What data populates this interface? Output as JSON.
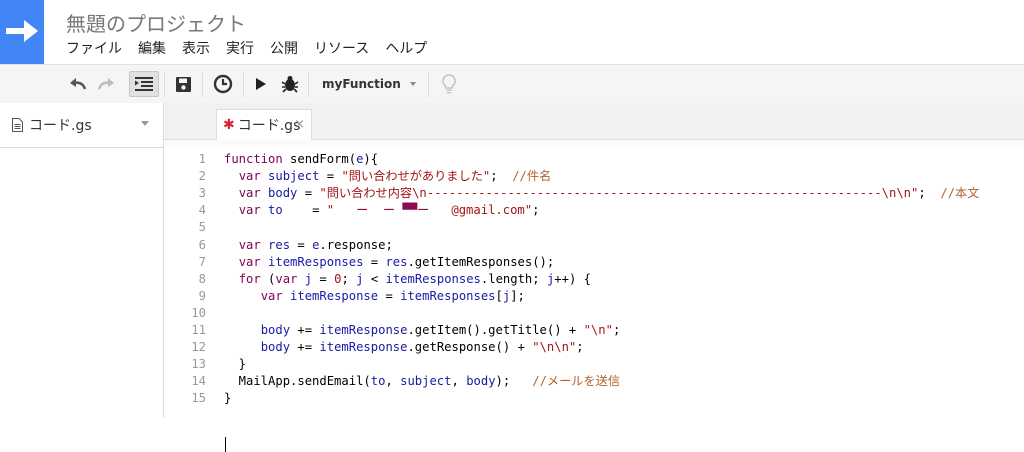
{
  "app": {
    "title": "無題のプロジェクト",
    "menu": [
      "ファイル",
      "編集",
      "表示",
      "実行",
      "公開",
      "リソース",
      "ヘルプ"
    ]
  },
  "toolbar": {
    "function_select": "myFunction"
  },
  "sidebar": {
    "file_label": "コード.gs"
  },
  "tab": {
    "star": "✱",
    "label": "コード.gs",
    "close": "×"
  },
  "editor": {
    "line_numbers": [
      "1",
      "2",
      "3",
      "4",
      "5",
      "6",
      "7",
      "8",
      "9",
      "10",
      "11",
      "12",
      "13",
      "14",
      "15"
    ],
    "lines": [
      [
        [
          "kw",
          "function"
        ],
        [
          "tx",
          " sendForm("
        ],
        [
          "vr",
          "e"
        ],
        [
          "tx",
          "){"
        ]
      ],
      [
        [
          "tx",
          "  "
        ],
        [
          "kw",
          "var"
        ],
        [
          "tx",
          " "
        ],
        [
          "vr",
          "subject"
        ],
        [
          "tx",
          " = "
        ],
        [
          "st",
          "\"問い合わせがありました\""
        ],
        [
          "tx",
          ";  "
        ],
        [
          "cm",
          "//件名"
        ]
      ],
      [
        [
          "tx",
          "  "
        ],
        [
          "kw",
          "var"
        ],
        [
          "tx",
          " "
        ],
        [
          "vr",
          "body"
        ],
        [
          "tx",
          " = "
        ],
        [
          "st",
          "\"問い合わせ内容\\n--------------------------------------------------------------\\n\\n\""
        ],
        [
          "tx",
          ";  "
        ],
        [
          "cm",
          "//本文"
        ]
      ],
      [
        [
          "tx",
          "  "
        ],
        [
          "kw",
          "var"
        ],
        [
          "tx",
          " "
        ],
        [
          "vr",
          "to"
        ],
        [
          "tx",
          "    = "
        ],
        [
          "st",
          "\"   "
        ],
        [
          "mask",
          "ー  ー ▀▀ー"
        ],
        [
          "st",
          "   @gmail.com\""
        ],
        [
          "tx",
          ";"
        ]
      ],
      [
        [
          "tx",
          ""
        ]
      ],
      [
        [
          "tx",
          "  "
        ],
        [
          "kw",
          "var"
        ],
        [
          "tx",
          " "
        ],
        [
          "vr",
          "res"
        ],
        [
          "tx",
          " = "
        ],
        [
          "vr",
          "e"
        ],
        [
          "tx",
          ".response;"
        ]
      ],
      [
        [
          "tx",
          "  "
        ],
        [
          "kw",
          "var"
        ],
        [
          "tx",
          " "
        ],
        [
          "vr",
          "itemResponses"
        ],
        [
          "tx",
          " = "
        ],
        [
          "vr",
          "res"
        ],
        [
          "tx",
          ".getItemResponses();"
        ]
      ],
      [
        [
          "tx",
          "  "
        ],
        [
          "kw",
          "for"
        ],
        [
          "tx",
          " ("
        ],
        [
          "kw",
          "var"
        ],
        [
          "tx",
          " "
        ],
        [
          "vr",
          "j"
        ],
        [
          "tx",
          " = "
        ],
        [
          "nu",
          "0"
        ],
        [
          "tx",
          "; "
        ],
        [
          "vr",
          "j"
        ],
        [
          "tx",
          " < "
        ],
        [
          "vr",
          "itemResponses"
        ],
        [
          "tx",
          ".length; "
        ],
        [
          "vr",
          "j"
        ],
        [
          "tx",
          "++) {"
        ]
      ],
      [
        [
          "tx",
          "     "
        ],
        [
          "kw",
          "var"
        ],
        [
          "tx",
          " "
        ],
        [
          "vr",
          "itemResponse"
        ],
        [
          "tx",
          " = "
        ],
        [
          "vr",
          "itemResponses"
        ],
        [
          "tx",
          "["
        ],
        [
          "vr",
          "j"
        ],
        [
          "tx",
          "];"
        ]
      ],
      [
        [
          "tx",
          ""
        ]
      ],
      [
        [
          "tx",
          "     "
        ],
        [
          "vr",
          "body"
        ],
        [
          "tx",
          " += "
        ],
        [
          "vr",
          "itemResponse"
        ],
        [
          "tx",
          ".getItem().getTitle() + "
        ],
        [
          "st",
          "\"\\n\""
        ],
        [
          "tx",
          ";"
        ]
      ],
      [
        [
          "tx",
          "     "
        ],
        [
          "vr",
          "body"
        ],
        [
          "tx",
          " += "
        ],
        [
          "vr",
          "itemResponse"
        ],
        [
          "tx",
          ".getResponse() + "
        ],
        [
          "st",
          "\"\\n\\n\""
        ],
        [
          "tx",
          ";"
        ]
      ],
      [
        [
          "tx",
          "  }"
        ]
      ],
      [
        [
          "tx",
          "  MailApp.sendEmail("
        ],
        [
          "vr",
          "to"
        ],
        [
          "tx",
          ", "
        ],
        [
          "vr",
          "subject"
        ],
        [
          "tx",
          ", "
        ],
        [
          "vr",
          "body"
        ],
        [
          "tx",
          ");   "
        ],
        [
          "cm",
          "//メールを送信"
        ]
      ],
      [
        [
          "tx",
          "}"
        ]
      ]
    ]
  }
}
